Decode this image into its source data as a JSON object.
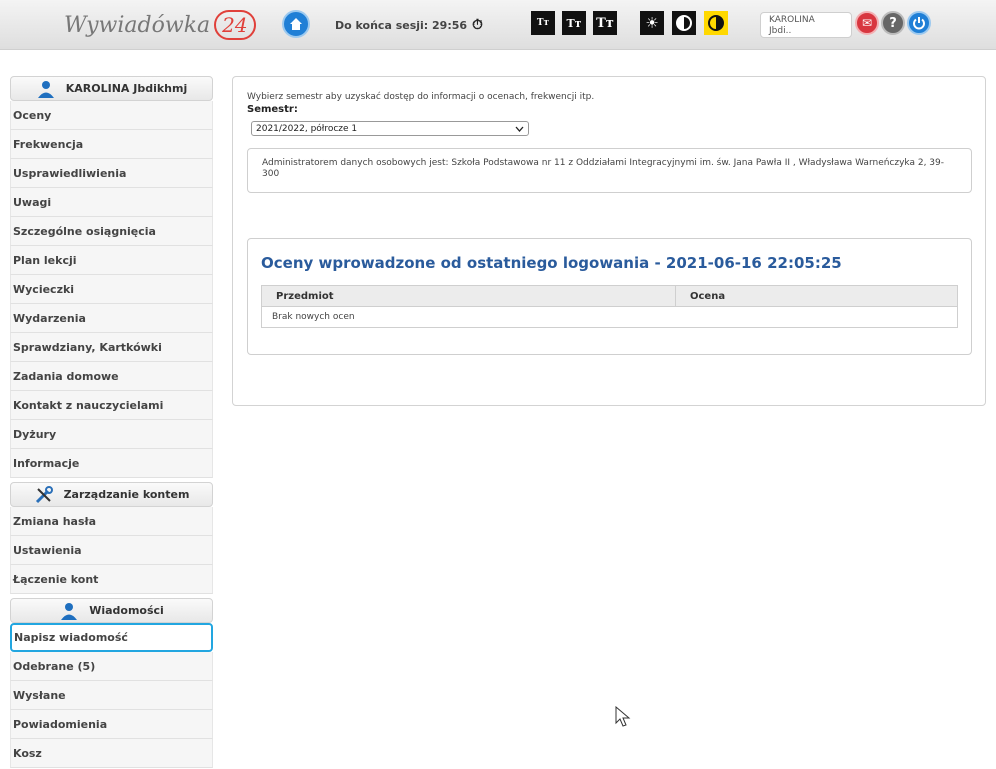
{
  "header": {
    "logo_text": "Wywiadówka",
    "logo_number": "24",
    "session_label": "Do końca sesji: 29:56",
    "font_buttons": [
      "Tт",
      "Tт",
      "Tт"
    ],
    "user_name": "KAROLINA",
    "user_sub": "Jbdi..",
    "icons": [
      "home-icon",
      "timer-icon",
      "sun-icon",
      "contrast-icon",
      "yellow-contrast-icon",
      "mail-icon",
      "help-icon",
      "power-icon"
    ],
    "colors": {
      "accent_blue": "#1f7fd6",
      "mail_red": "#d8363f",
      "title_blue": "#2a5b9c",
      "active_border": "#22a6e0"
    }
  },
  "sidebar": {
    "student": {
      "title": "KAROLINA Jbdikhmj",
      "items": [
        "Oceny",
        "Frekwencja",
        "Usprawiedliwienia",
        "Uwagi",
        "Szczególne osiągnięcia",
        "Plan lekcji",
        "Wycieczki",
        "Wydarzenia",
        "Sprawdziany, Kartkówki",
        "Zadania domowe",
        "Kontakt z nauczycielami",
        "Dyżury",
        "Informacje"
      ]
    },
    "account": {
      "title": "Zarządzanie kontem",
      "items": [
        "Zmiana hasła",
        "Ustawienia",
        "Łączenie kont"
      ]
    },
    "messages": {
      "title": "Wiadomości",
      "items": [
        "Napisz wiadomość",
        "Odebrane (5)",
        "Wysłane",
        "Powiadomienia",
        "Kosz"
      ]
    }
  },
  "main": {
    "intro": "Wybierz semestr aby uzyskać dostęp do informacji o ocenach, frekwencji itp.",
    "semester_label": "Semestr:",
    "semester_value": "2021/2022, półrocze 1",
    "admin_text": "Administratorem danych osobowych jest: Szkoła Podstawowa nr 11 z Oddziałami Integracyjnymi im. św. Jana Pawła II , Władysława Warneńczyka 2, 39-300",
    "grades_title": "Oceny wprowadzone od ostatniego logowania - 2021-06-16 22:05:25",
    "table_headers": [
      "Przedmiot",
      "Ocena"
    ],
    "empty_text": "Brak nowych ocen"
  }
}
